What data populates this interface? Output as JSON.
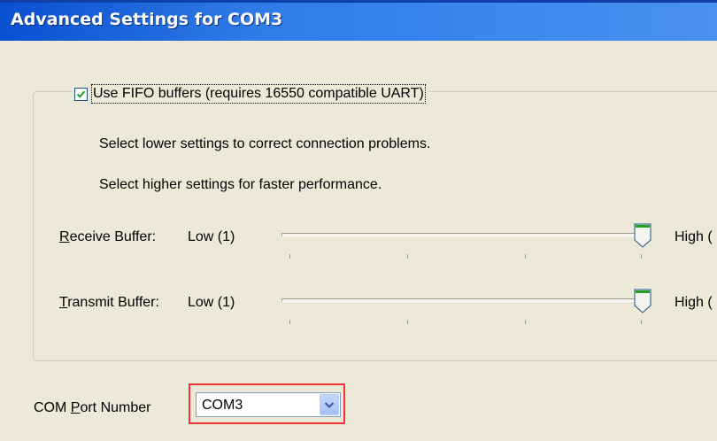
{
  "window": {
    "title": "Advanced Settings for COM3"
  },
  "fifo": {
    "checked": true,
    "label": "Use FIFO buffers (requires 16550 compatible UART)"
  },
  "info": {
    "line1": "Select lower settings to correct connection problems.",
    "line2": "Select higher settings for faster performance."
  },
  "receive": {
    "label_underlined": "R",
    "label_rest": "eceive Buffer:",
    "low_label": "Low (1)",
    "high_label": "High (",
    "value_fraction": 1.0
  },
  "transmit": {
    "label_underlined": "T",
    "label_rest": "ransmit Buffer:",
    "low_label": "Low (1)",
    "high_label": "High (",
    "value_fraction": 1.0
  },
  "com_port": {
    "label_before": "COM ",
    "label_underlined": "P",
    "label_after": "ort Number",
    "selected": "COM3"
  },
  "icons": {
    "checkbox": "checkmark-icon",
    "dropdown": "chevron-down-icon",
    "slider_thumb": "slider-thumb-icon"
  },
  "colors": {
    "titlebar": "#0a4fd0",
    "highlight_border": "#ee3333",
    "dialog_bg": "#ece9d8"
  }
}
